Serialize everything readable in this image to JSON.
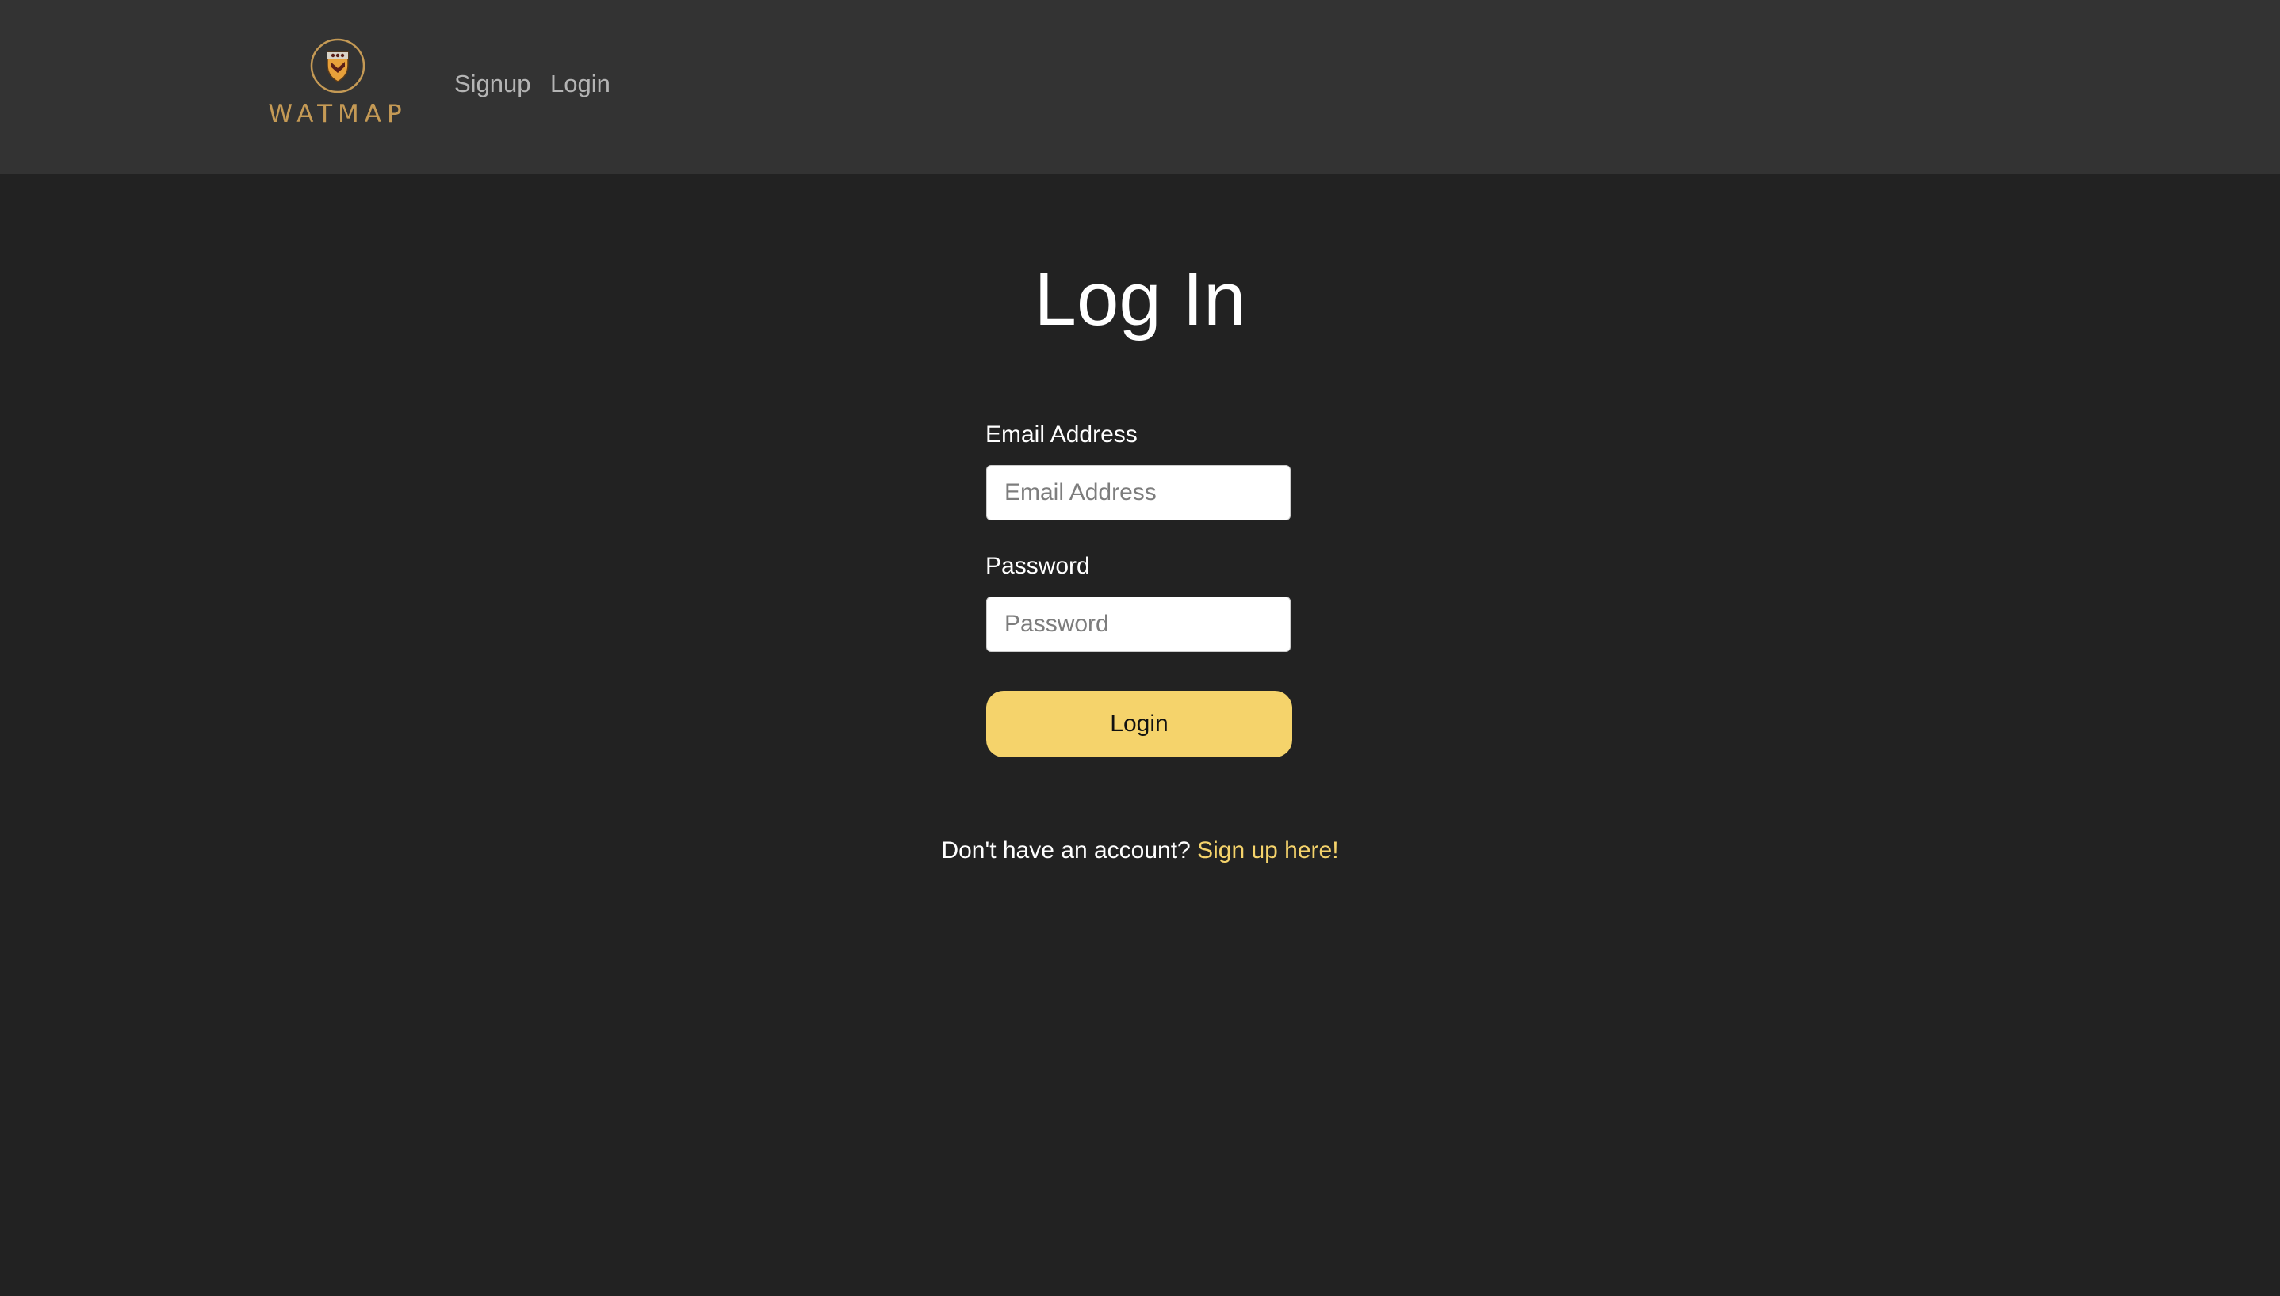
{
  "navbar": {
    "brand_name": "WATMAP",
    "links": [
      {
        "label": "Signup"
      },
      {
        "label": "Login"
      }
    ]
  },
  "main": {
    "title": "Log In",
    "email": {
      "label": "Email Address",
      "placeholder": "Email Address",
      "value": ""
    },
    "password": {
      "label": "Password",
      "placeholder": "Password",
      "value": ""
    },
    "submit_label": "Login",
    "signup_prompt": "Don't have an account?",
    "signup_link": "Sign up here!"
  },
  "colors": {
    "page_background": "#222222",
    "navbar_background": "#333333",
    "accent": "#f5d36b",
    "brand_gold": "#c59a55",
    "nav_text": "#b4b4b4"
  },
  "icons": {
    "logo": "university-crest-icon"
  }
}
